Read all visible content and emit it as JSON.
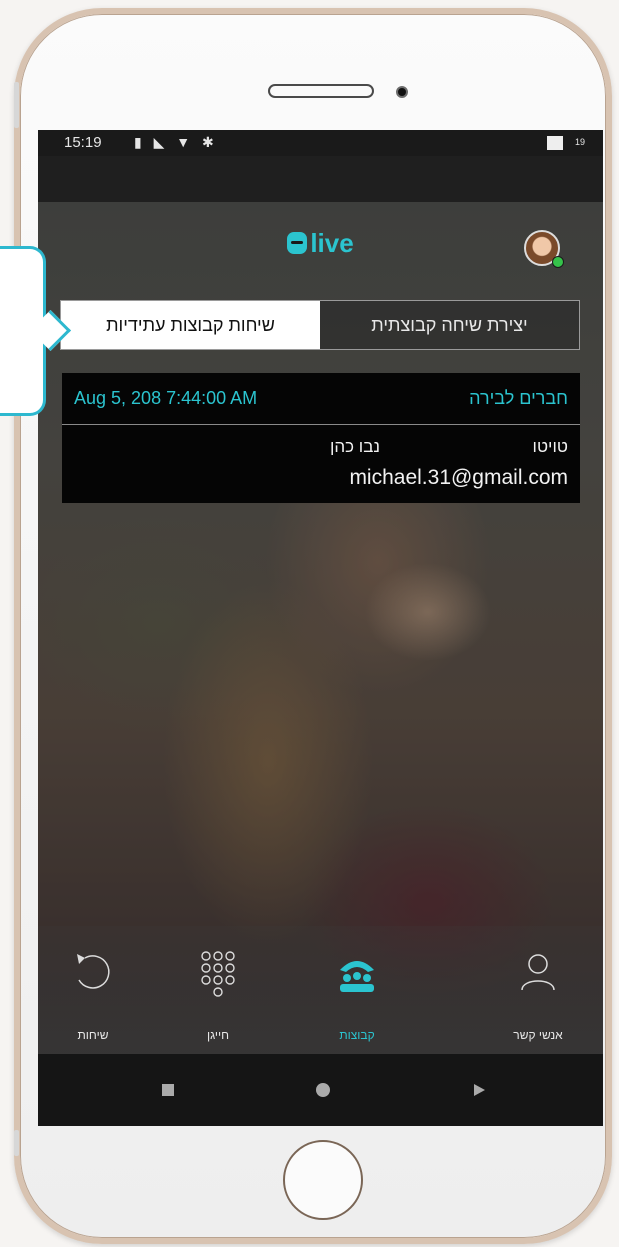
{
  "status_bar": {
    "time": "15:19",
    "icons": "▮ ◣ ▼ ✱",
    "battery_percent": "19"
  },
  "app": {
    "logo_text": "live",
    "accent_color": "#2bc4cf"
  },
  "tabs": [
    {
      "label": "יצירת שיחה קבוצתית",
      "active": false
    },
    {
      "label": "שיחות קבוצות עתידיות",
      "active": true
    }
  ],
  "card": {
    "group_name": "חברים לבירה",
    "date": "Aug 5, 208 7:44:00 AM",
    "user_label": "טויטו",
    "contact_name": "נבו כהן",
    "email": "michael.31@gmail.com"
  },
  "bottom_nav": [
    {
      "label": "אנשי קשר",
      "icon": "contact-person-icon"
    },
    {
      "label": "קבוצות",
      "icon": "group-call-icon",
      "active": true
    },
    {
      "label": "חייגן",
      "icon": "dialpad-icon"
    },
    {
      "label": "שיחות",
      "icon": "call-history-icon"
    }
  ],
  "system_nav": {
    "icons": [
      "recent-apps-icon",
      "home-icon",
      "back-icon"
    ]
  }
}
